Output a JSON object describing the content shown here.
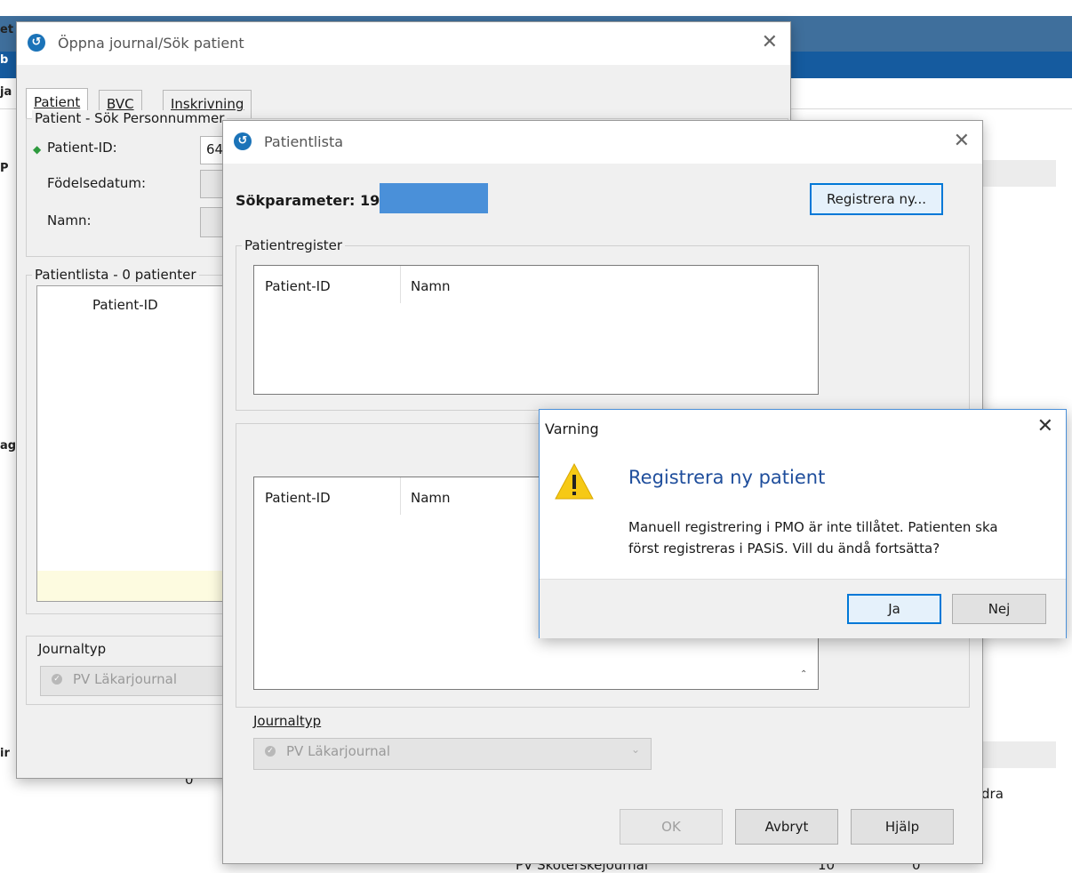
{
  "background_app": {
    "menu_fragments": [
      "et",
      "b",
      "ja",
      "P",
      "ag",
      "ir"
    ],
    "bottom_texts": [
      "0",
      "dra",
      "PV Sköterskejournal",
      "10",
      "0"
    ]
  },
  "search_dialog": {
    "title": "Öppna journal/Sök patient",
    "icon": "app-logo-icon",
    "tabs": [
      "Patient",
      "BVC",
      "Inskrivning"
    ],
    "group_search": "Patient - Sök Personnummer",
    "fields": {
      "patient_id_label": "Patient-ID:",
      "patient_id_value": "64",
      "birthdate_label": "Födelsedatum:",
      "name_label": "Namn:"
    },
    "patient_list_label": "Patientlista - 0 patienter",
    "column_patient_id": "Patient-ID",
    "journaltyp_label": "Journaltyp",
    "journaltyp_value": "PV Läkarjournal"
  },
  "patientlista_dialog": {
    "title": "Patientlista",
    "search_param_label": "Sökparameter: 19",
    "register_button": "Registrera ny...",
    "patientregister_label": "Patientregister",
    "columns": [
      "Patient-ID",
      "Namn"
    ],
    "journaltyp_label": "Journaltyp",
    "journaltyp_value": "PV Läkarjournal",
    "ok_button": "OK",
    "cancel_button": "Avbryt",
    "help_button": "Hjälp"
  },
  "warning_dialog": {
    "title": "Varning",
    "heading": "Registrera ny patient",
    "message_line1": "Manuell registrering i PMO är inte tillåtet. Patienten ska",
    "message_line2": "först registreras i PASiS. Vill du ändå fortsätta?",
    "yes_button": "Ja",
    "no_button": "Nej",
    "icon": "warning-icon"
  },
  "colors": {
    "titlebar_blue": "#3f6f9c",
    "accent_blue": "#155b9f",
    "heading_blue": "#1f4e9c",
    "warning_yellow": "#f6c915",
    "redaction_blue": "#4a90d9",
    "required_green": "#2e9a3e"
  }
}
